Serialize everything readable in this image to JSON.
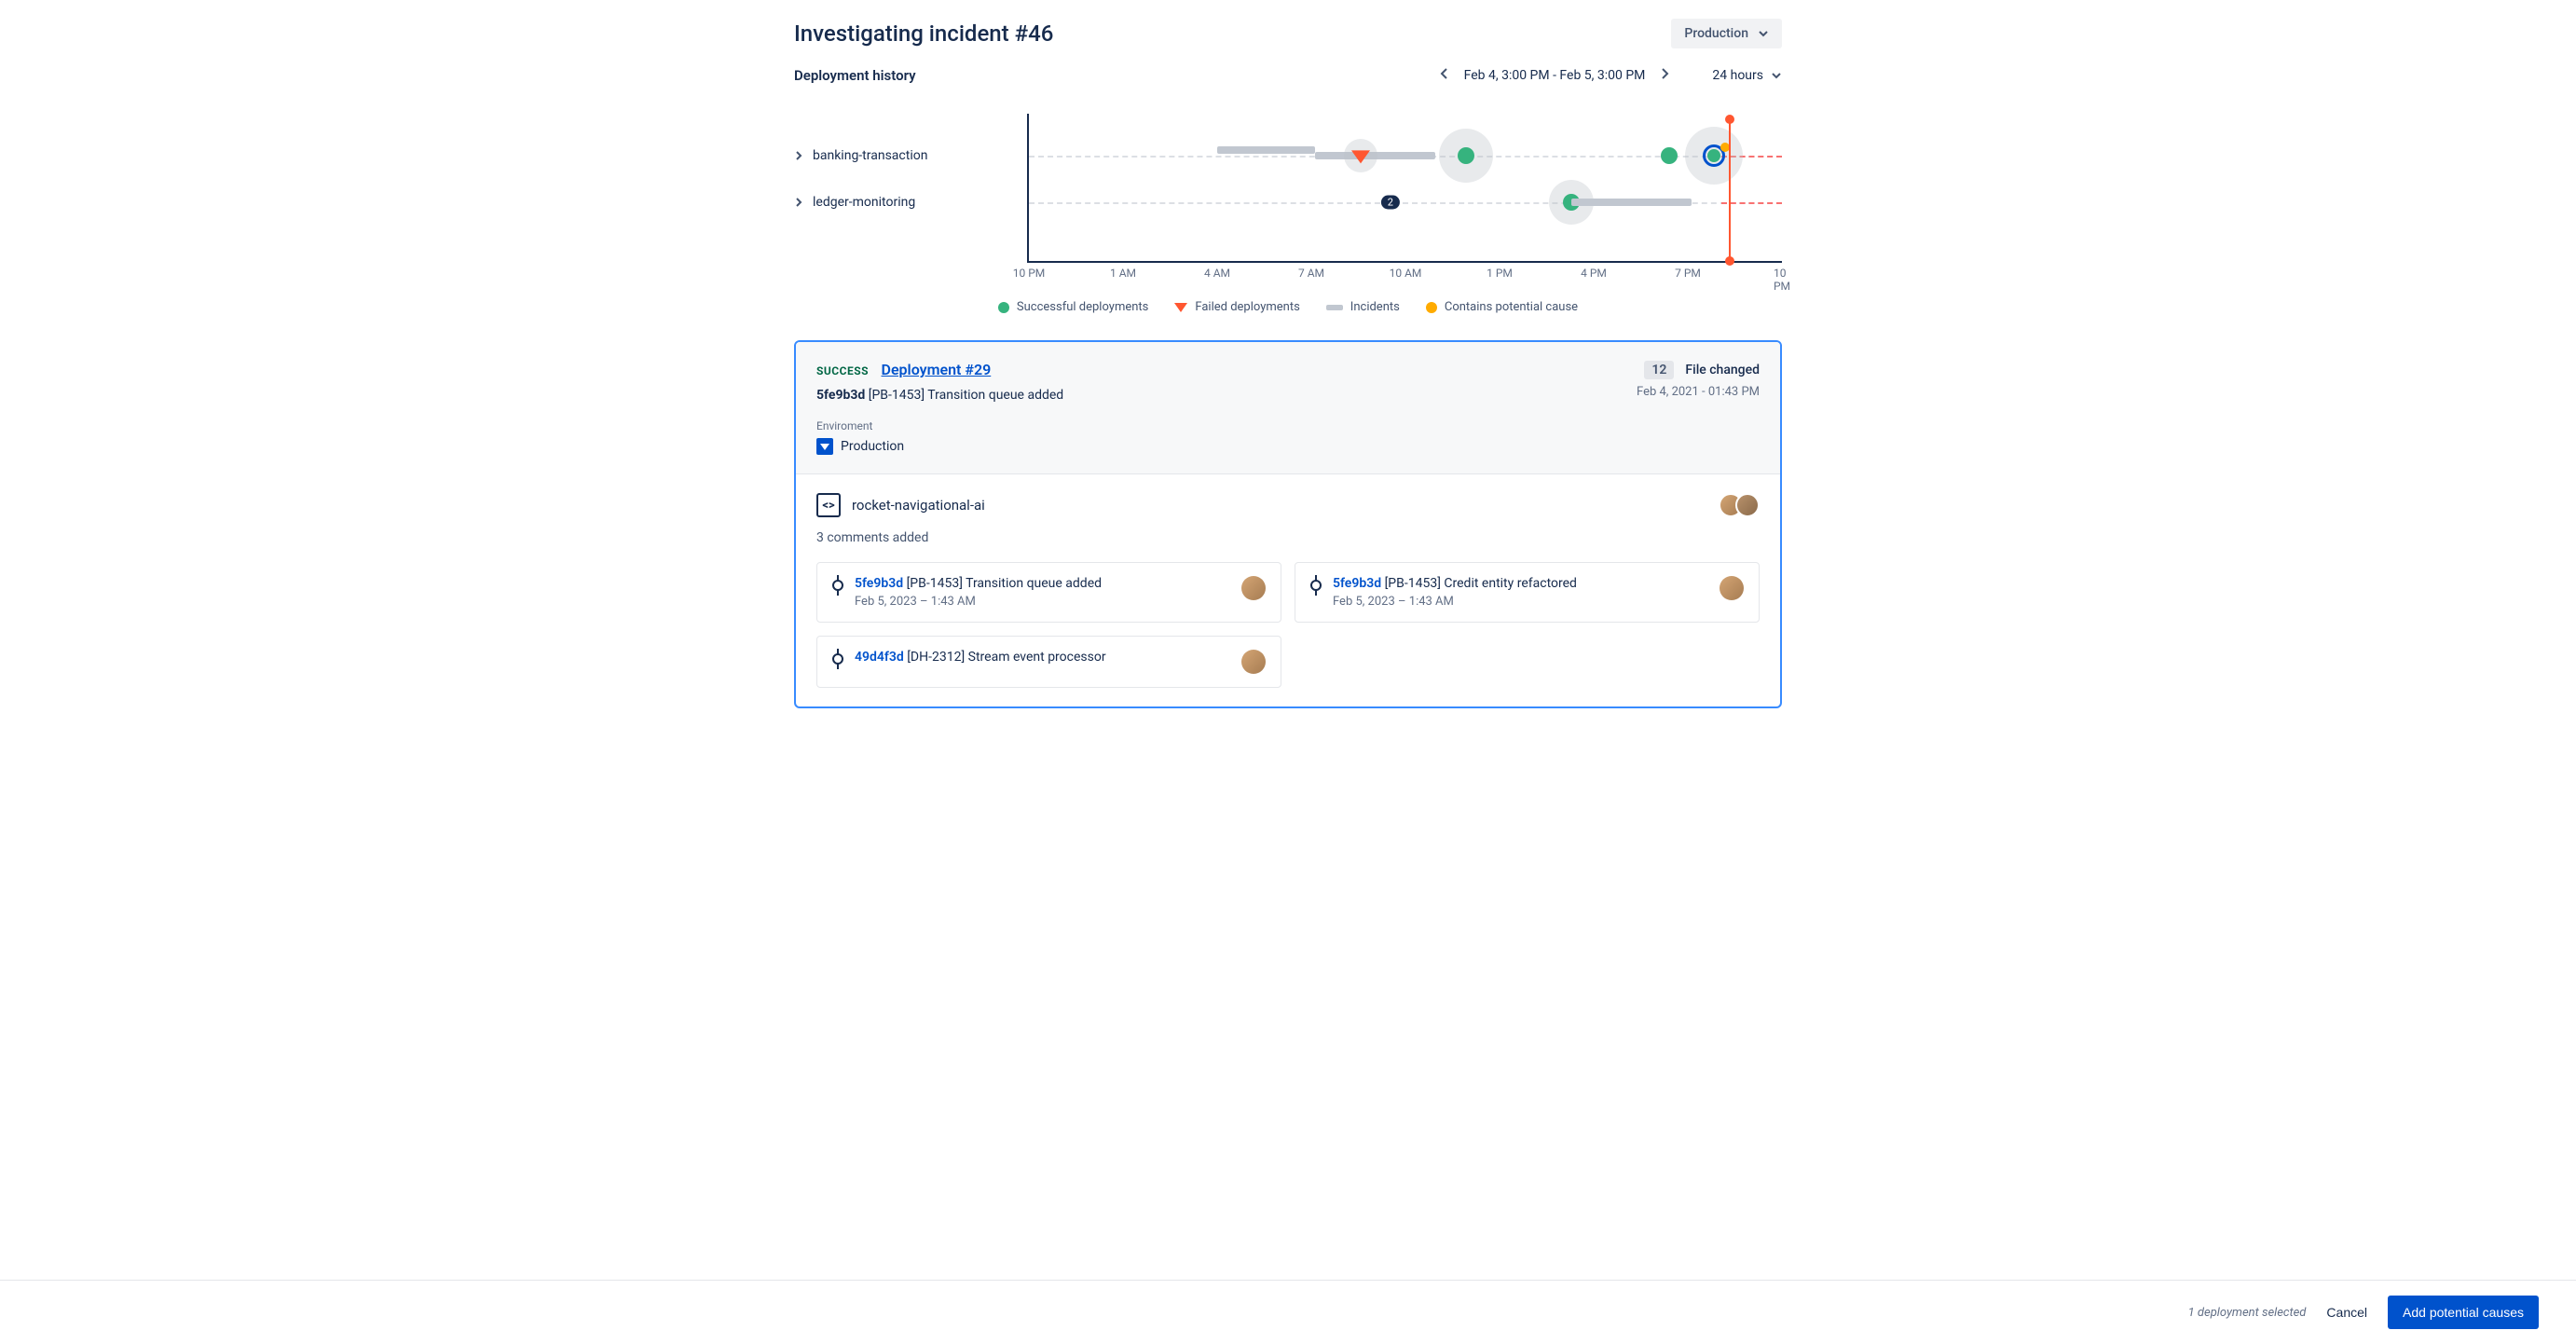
{
  "header": {
    "title": "Investigating incident #46",
    "env_dropdown": "Production"
  },
  "subheader": {
    "title": "Deployment history",
    "date_range": "Feb 4, 3:00 PM - Feb 5, 3:00 PM",
    "range_selector": "24 hours"
  },
  "timeline": {
    "rows": [
      {
        "label": "banking-transaction"
      },
      {
        "label": "ledger-monitoring"
      }
    ],
    "x_ticks": [
      "10 PM",
      "1 AM",
      "4 AM",
      "7 AM",
      "10 AM",
      "1 PM",
      "4 PM",
      "7 PM",
      "10 PM"
    ],
    "count_badge": "2"
  },
  "legend": {
    "success": "Successful deployments",
    "failed": "Failed deployments",
    "incidents": "Incidents",
    "cause": "Contains potential cause"
  },
  "details": {
    "status": "SUCCESS",
    "deployment_link": "Deployment #29",
    "commit_hash": "5fe9b3d",
    "ticket": "[PB-1453]",
    "commit_msg": "Transition queue added",
    "env_label": "Enviroment",
    "env_value": "Production",
    "file_count": "12",
    "file_changed_label": "File changed",
    "timestamp": "Feb 4, 2021 - 01:43 PM",
    "repo_name": "rocket-navigational-ai",
    "comments_added": "3 comments added",
    "commits": [
      {
        "hash": "5fe9b3d",
        "ticket": "[PB-1453]",
        "msg": "Transition queue added",
        "date": "Feb 5, 2023 – 1:43 AM"
      },
      {
        "hash": "5fe9b3d",
        "ticket": "[PB-1453]",
        "msg": "Credit entity refactored",
        "date": "Feb 5, 2023 – 1:43 AM"
      },
      {
        "hash": "49d4f3d",
        "ticket": "[DH-2312]",
        "msg": "Stream event processor",
        "date": ""
      }
    ]
  },
  "footer": {
    "selected": "1 deployment selected",
    "cancel": "Cancel",
    "add": "Add potential causes"
  },
  "chart_data": {
    "type": "timeline",
    "x_ticks": [
      "10 PM",
      "1 AM",
      "4 AM",
      "7 AM",
      "10 AM",
      "1 PM",
      "4 PM",
      "7 PM",
      "10 PM"
    ],
    "now_position_pct": 93,
    "rows": [
      {
        "name": "banking-transaction",
        "events": [
          {
            "type": "incident",
            "start_pct": 25,
            "end_pct": 38
          },
          {
            "type": "incident",
            "start_pct": 38,
            "end_pct": 54
          },
          {
            "type": "failed",
            "pos_pct": 44,
            "halo": true
          },
          {
            "type": "success",
            "pos_pct": 58,
            "halo": true
          },
          {
            "type": "success",
            "pos_pct": 85
          },
          {
            "type": "success",
            "pos_pct": 91,
            "halo": true,
            "selected": true,
            "potential_cause": true
          }
        ]
      },
      {
        "name": "ledger-monitoring",
        "events": [
          {
            "type": "count",
            "pos_pct": 48,
            "value": 2
          },
          {
            "type": "success",
            "pos_pct": 72,
            "halo": true
          },
          {
            "type": "incident",
            "start_pct": 72,
            "end_pct": 88
          }
        ]
      }
    ]
  }
}
